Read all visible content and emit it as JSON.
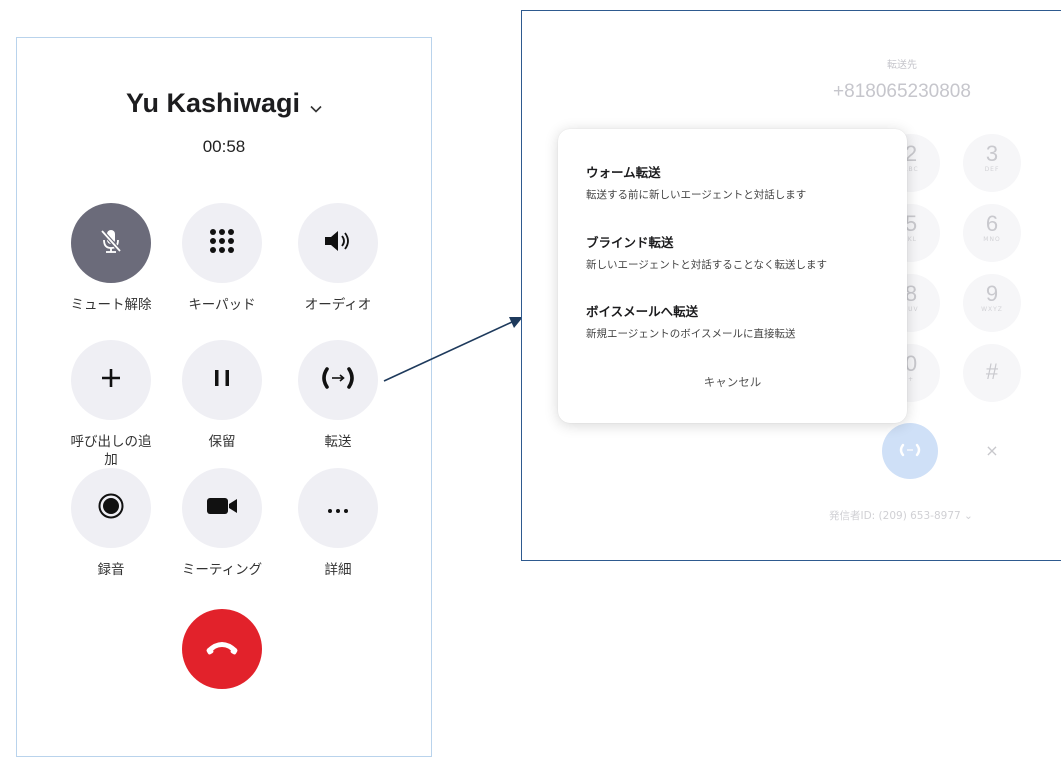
{
  "call": {
    "caller_name": "Yu Kashiwagi",
    "duration": "00:58",
    "controls": [
      {
        "id": "mute",
        "label": "ミュート解除",
        "icon": "mic-off-icon"
      },
      {
        "id": "keypad",
        "label": "キーパッド",
        "icon": "keypad-icon"
      },
      {
        "id": "audio",
        "label": "オーディオ",
        "icon": "speaker-icon"
      },
      {
        "id": "add-call",
        "label": "呼び出しの追加",
        "icon": "plus-icon"
      },
      {
        "id": "hold",
        "label": "保留",
        "icon": "pause-icon"
      },
      {
        "id": "transfer",
        "label": "転送",
        "icon": "transfer-icon"
      },
      {
        "id": "record",
        "label": "録音",
        "icon": "record-icon"
      },
      {
        "id": "meeting",
        "label": "ミーティング",
        "icon": "video-icon"
      },
      {
        "id": "more",
        "label": "詳細",
        "icon": "more-icon"
      }
    ]
  },
  "transfer": {
    "destination_label": "転送先",
    "destination_number": "+818065230808",
    "keypad": [
      {
        "digit": "2",
        "letters": "ABC"
      },
      {
        "digit": "3",
        "letters": "DEF"
      },
      {
        "digit": "5",
        "letters": "JKL"
      },
      {
        "digit": "6",
        "letters": "MNO"
      },
      {
        "digit": "8",
        "letters": "TUV"
      },
      {
        "digit": "9",
        "letters": "WXYZ"
      },
      {
        "digit": "0",
        "letters": "+"
      },
      {
        "digit": "#",
        "letters": ""
      }
    ],
    "close_symbol": "×",
    "caller_id": "発信者ID: (209) 653-8977 ⌄",
    "menu": {
      "options": [
        {
          "title": "ウォーム転送",
          "desc": "転送する前に新しいエージェントと対話します"
        },
        {
          "title": "ブラインド転送",
          "desc": "新しいエージェントと対話することなく転送します"
        },
        {
          "title": "ボイスメールへ転送",
          "desc": "新規エージェントのボイスメールに直接転送"
        }
      ],
      "cancel": "キャンセル"
    }
  },
  "colors": {
    "mute_active": "#6b6b7a",
    "end_call": "#e2222b",
    "panel_border_left": "#b9d3ec",
    "panel_border_right": "#2e5a8f",
    "arrow": "#1e3a5c"
  }
}
